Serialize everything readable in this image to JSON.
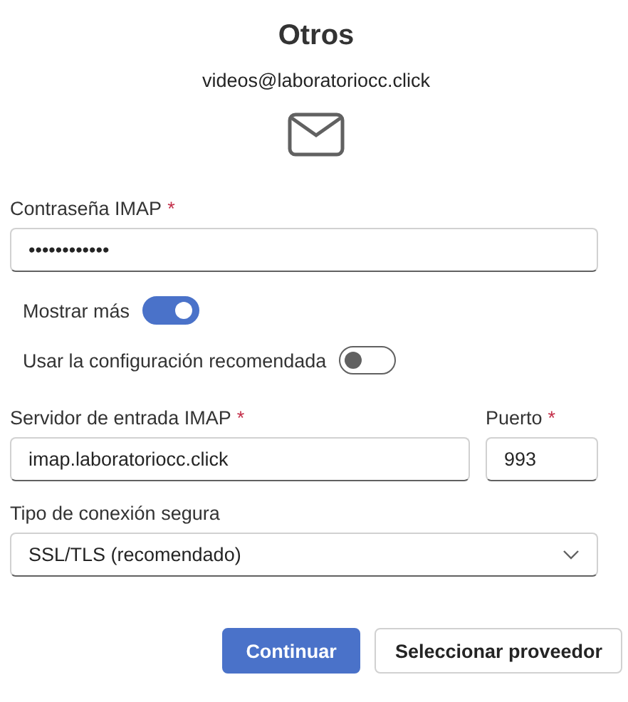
{
  "title": "Otros",
  "account": "videos@laboratoriocc.click",
  "password": {
    "label": "Contraseña IMAP",
    "required_mark": "*",
    "value": "••••••••••••"
  },
  "toggles": [
    {
      "label": "Mostrar más",
      "on": true
    },
    {
      "label": "Usar la configuración recomendada",
      "on": false
    }
  ],
  "server": {
    "label": "Servidor de entrada IMAP",
    "required_mark": "*",
    "value": "imap.laboratoriocc.click"
  },
  "port": {
    "label": "Puerto",
    "required_mark": "*",
    "value": "993"
  },
  "security": {
    "label": "Tipo de conexión segura",
    "value": "SSL/TLS (recomendado)"
  },
  "buttons": [
    {
      "label": "Continuar",
      "kind": "primary"
    },
    {
      "label": "Seleccionar proveedor",
      "kind": "secondary"
    }
  ]
}
